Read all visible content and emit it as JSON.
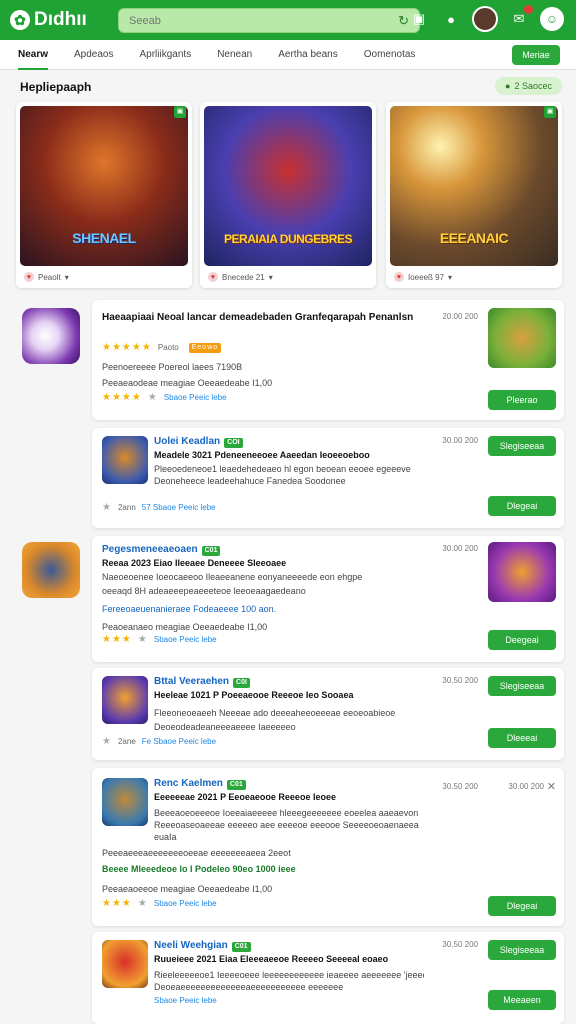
{
  "header": {
    "brand": "Dıdhıı",
    "search_placeholder": "Seeab",
    "colors": {
      "primary": "#21a235",
      "link": "#1565c0",
      "star": "#f5b400"
    }
  },
  "tabs": [
    {
      "label": "Nearw",
      "active": true
    },
    {
      "label": "Apdeaos",
      "active": false
    },
    {
      "label": "Aprliikgants",
      "active": false
    },
    {
      "label": "Nenean",
      "active": false
    },
    {
      "label": "Aertha beans",
      "active": false
    },
    {
      "label": "Oomenotas",
      "active": false
    }
  ],
  "tab_button": "Meriae",
  "section": {
    "title": "Hepliepaaph",
    "pill": "2 Saocec"
  },
  "featured": [
    {
      "title": "SHENAEL",
      "meta": "Peaolt"
    },
    {
      "title": "PERAIAIA DUNGEBRES",
      "meta": "Bnecede 21"
    },
    {
      "title": "EEEANAIC",
      "meta": "Ioeeeß 97"
    }
  ],
  "apps": [
    {
      "name": "Haeaapiaai Neoal lancar demeadebaden Granfeqarapah Penanlsn",
      "rating_count": "Paoto",
      "chip": "Eeowo",
      "line1": "Peenoereeee Poereol laees 7190B",
      "line2": "Peeaeaodeae meagiae Oeeaedeabe I1,00",
      "link": "Sbaoe Peeic lebe",
      "size": "20.00 200",
      "button": "Pleerao"
    },
    {
      "name": "Uolei Keadlan",
      "chip": "COI",
      "line_b": "Meadele 3021 Pdeneeneeoee Aaeedan Ieoeeoeboo",
      "line1": "Pleeoedeneoe1 leaedehedeaeo hl egon beoean eeoee egeeeve",
      "line2": "Deoneheece leadeehahuce Fanedea Soodonee",
      "rating_count": "2ann",
      "link": "57 Sbaoe Peeic lebe",
      "size": "30.00 200",
      "button_top": "Slegiseeaa",
      "button": "Dlegeai"
    },
    {
      "name": "Pegesmeneeaeoaen",
      "chip": "C01",
      "line_b": "Reeaa 2023 Eiao Ileeaee Deneeee Sleeoaee",
      "line1": "Naeoeoenee Ioeocaeeoo Ileaeeanene eonyaneeeede eon ehgpe",
      "line2": "oeeaqd 8H adeaeeepeaeeeteoe leeoeaagaedeano",
      "line3": "Fereeoaeuenanieraee Fodeaeeee 100 aon.",
      "line4": "Peaoeanaeo meagiae Oeeaedeabe I1,00",
      "link": "Sbaoe Peeic lebe",
      "size": "30.00 200",
      "button": "Deegeai"
    },
    {
      "name": "Bttal Veeraehen",
      "chip": "C0I",
      "line_b": "Heeleae 1021 P Poeeaeooe Reeeoe Ieo Sooaea",
      "line1": "Fleeoneoeaeeh Neeeae ado deeeaheeoeeeae eeoeoabieoe",
      "line2": "Deoeodeadeaneeeaeeee Iaeeeeeo",
      "rating_count": "2ane",
      "link": "Fe Sbaoe Peeic lebe",
      "size": "30.50 200",
      "button_top": "Slegiseeaa",
      "button": "Dleeeai"
    },
    {
      "name": "Renc Kaelmen",
      "chip": "C01",
      "line_b": "Eeeeeeae 2021 P Eeoeaeooe Reeeoe Ieoee",
      "line1": "Beeeaoeoeeeoe Ioeeaiaeeeee hleeegeeeeeee eoeelea aaeaevon",
      "line2": "Reeeoaseoaeeae eeeeeo aee eeeeoe eeeooe Seeeeoeoaenaeea",
      "line3": "euaIa",
      "line4": "Peeeaeeeaeeeeeeeoeeae eeeeeeeaeea 2eeot",
      "line5": "Beeee Mleeedeoe lo I Podeleo 90eo 1000 ieee",
      "line6": "Peeaeaoeeoe meagiae Oeeaedeabe I1,00",
      "link": "Sbaoe Peeic lebe",
      "size": "30.50 200",
      "size2": "30.00 200",
      "button": "Dlegeai"
    },
    {
      "name": "Neeli Weehgian",
      "chip": "C01",
      "line_b": "Ruueieee 2021 Eiaa Eleeeaeeoe Reeeeo Seeeeal eoaeo",
      "line1": "Rieeleeeeeoe1 Ieeeeoeee leeeeeeeeeeee ieaeeee aeeeeeee 'jeeee",
      "line2": "Deoeaeeeeeeeeeeeeeaeeeeeeeeeee eeeeeee",
      "link": "Sbaoe Peeic lebe",
      "size": "30.50 200",
      "button_top": "Slegiseeaa",
      "button": "Meeaeen"
    }
  ]
}
